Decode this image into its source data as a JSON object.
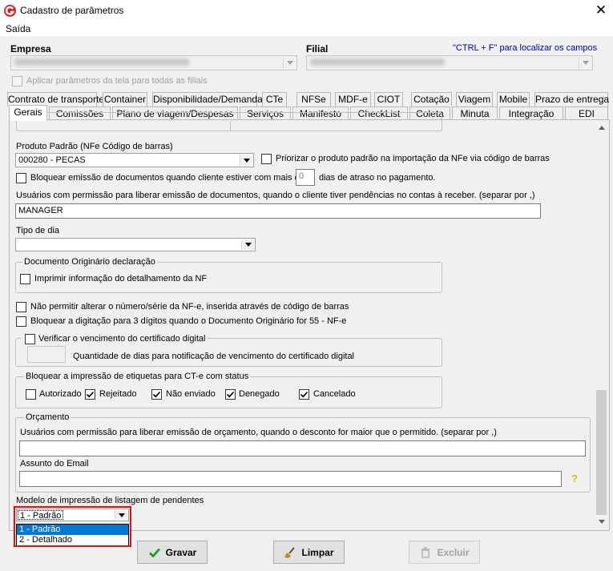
{
  "window": {
    "title": "Cadastro de parâmetros"
  },
  "menu": {
    "items": [
      "Saída"
    ]
  },
  "header": {
    "empresa_label": "Empresa",
    "filial_label": "Filial",
    "hint": "\"CTRL + F\" para localizar os campos",
    "apply_all_label": "Aplicar parâmetros da tela para todas as filiais"
  },
  "tabs_row1": [
    "Contrato de transporte",
    "Container",
    "Disponibilidade/Demanda",
    "CTe",
    "NFSe",
    "MDF-e",
    "CIOT",
    "Cotação",
    "Viagem",
    "Mobile",
    "Prazo de entrega"
  ],
  "tabs_row2": [
    "Gerais",
    "Comissões",
    "Plano de viagem/Despesas",
    "Serviços",
    "Manifesto",
    "CheckList",
    "Coleta",
    "Minuta",
    "Integração",
    "EDI"
  ],
  "gerais": {
    "produto_label": "Produto Padrão (NFe Código de barras)",
    "produto_value": "000280 - PECAS",
    "priorizar_label": "Priorizar o produto padrão na importação da NFe via código de barras",
    "bloquear_prefix": "Bloquear emissão de documentos quando cliente estiver com mais de",
    "bloquear_days": "0",
    "bloquear_suffix": "dias de atraso no pagamento.",
    "usuarios_label": "Usuários com permissão para liberar emissão de documentos, quando o cliente tiver pendências no contas à receber. (separar por ,)",
    "usuarios_value": "MANAGER",
    "tipo_dia_label": "Tipo de dia",
    "tipo_dia_value": "",
    "doc_origin_group": "Documento Originário declaração",
    "imprimir_label": "Imprimir informação do detalhamento da NF",
    "nao_permitir_label": "Não permitir alterar o número/série da NF-e, inserida através de código de barras",
    "bloquear_digit_label": "Bloquear a digitação para 3 dígitos quando o Documento Originário for 55 - NF-e",
    "verificar_label": "Verificar o vencimento do certificado digital",
    "qtd_dias_label": "Quantidade de dias para notificação de vencimento do certificado digital",
    "etiquetas_group": "Bloquear a impressão de etiquetas para CT-e com status",
    "statuses": [
      {
        "label": "Autorizado",
        "checked": false
      },
      {
        "label": "Rejeitado",
        "checked": true
      },
      {
        "label": "Não enviado",
        "checked": true
      },
      {
        "label": "Denegado",
        "checked": true
      },
      {
        "label": "Cancelado",
        "checked": true
      }
    ],
    "orcamento_group": "Orçamento",
    "orcamento_usuarios_label": "Usuários com permissão para liberar emissão de orçamento, quando o desconto for maior que o permitido. (separar por ,)",
    "orcamento_usuarios_value": "",
    "assunto_label": "Assunto do Email",
    "assunto_value": "",
    "help_glyph": "?",
    "modelo_label": "Modelo de impressão de listagem de pendentes",
    "modelo_value": "1 - Padrão",
    "modelo_options": [
      "1 - Padrão",
      "2 - Detalhado"
    ]
  },
  "buttons": {
    "gravar": "Gravar",
    "limpar": "Limpar",
    "excluir": "Excluir"
  },
  "colors": {
    "accent_red": "#e01010",
    "selection_blue": "#0078d7",
    "hint_blue": "#0000a8"
  }
}
